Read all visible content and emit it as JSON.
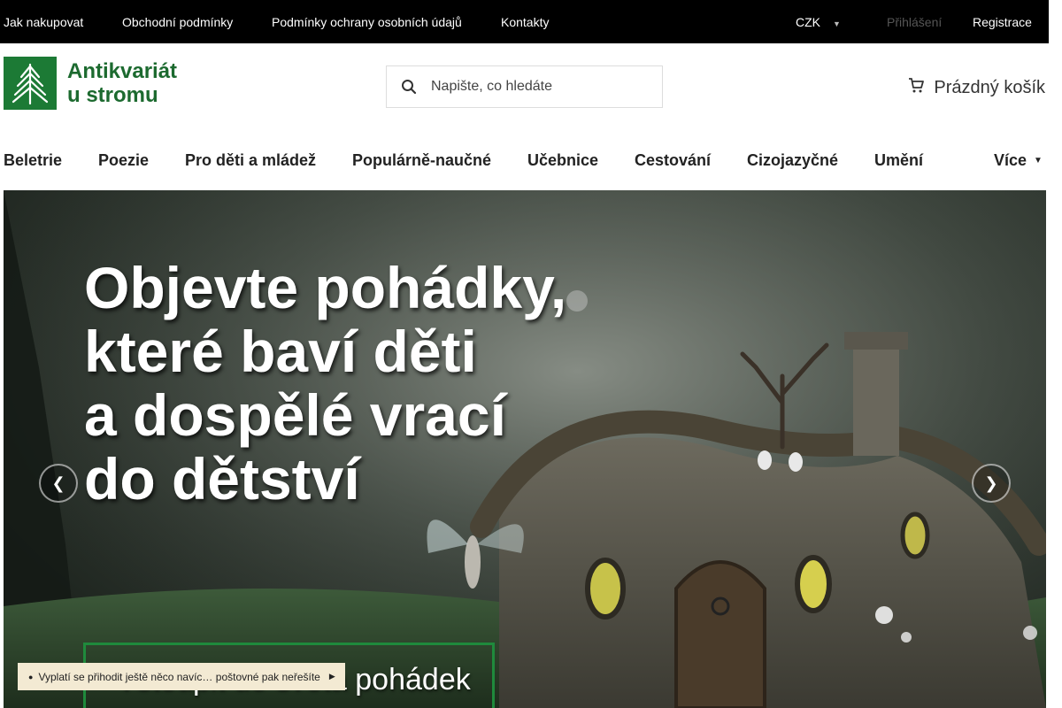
{
  "topbar": {
    "links": [
      "Jak nakupovat",
      "Obchodní podmínky",
      "Podmínky ochrany osobních údajů",
      "Kontakty"
    ],
    "currency": "CZK",
    "login": "Přihlášení",
    "register": "Registrace"
  },
  "header": {
    "logo_line1": "Antikvariát",
    "logo_line2": "u stromu",
    "search_placeholder": "Napište, co hledáte",
    "cart_label": "Prázdný košík"
  },
  "nav": {
    "items": [
      "Beletrie",
      "Poezie",
      "Pro děti a mládež",
      "Populárně-naučné",
      "Učebnice",
      "Cestování",
      "Cizojazyčné",
      "Umění"
    ],
    "more": "Více"
  },
  "hero": {
    "line1": "Objevte pohádky,",
    "line2": "které baví děti",
    "line3": "a dospělé vrací",
    "line4": "do dětství",
    "cta": "Vstoupit do světa pohádek"
  },
  "notice": {
    "text": "Vyplatí se přihodit ještě něco navíc… poštovné pak neřešíte"
  },
  "colors": {
    "brand_green": "#1c7a35",
    "topbar_bg": "#000000",
    "notice_bg": "#f3ead3"
  }
}
